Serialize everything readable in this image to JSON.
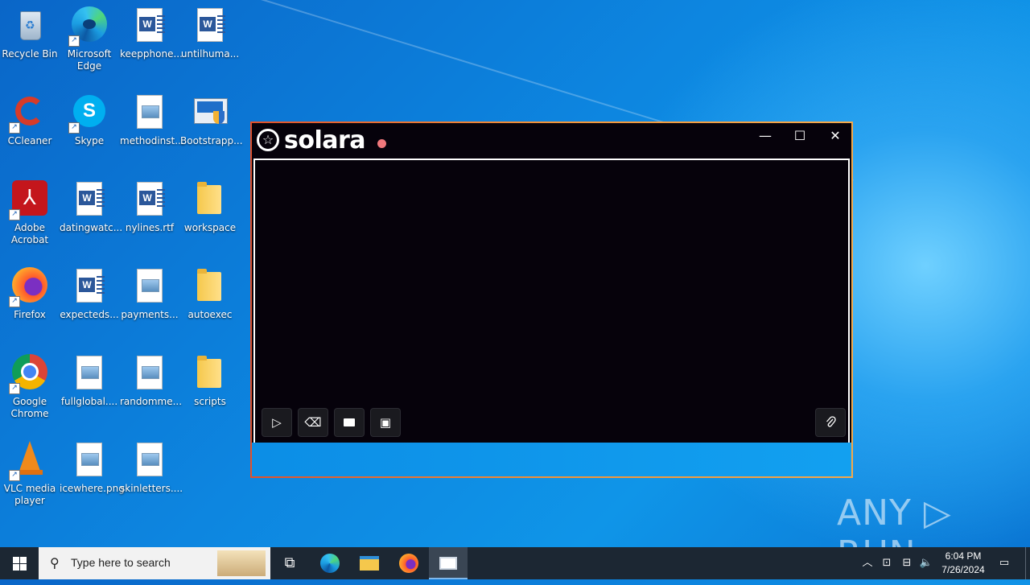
{
  "desktop": {
    "icons": [
      {
        "label": "Recycle Bin",
        "type": "recycle-bin"
      },
      {
        "label": "Microsoft Edge",
        "type": "edge"
      },
      {
        "label": "keepphone...",
        "type": "word"
      },
      {
        "label": "untilhuma...",
        "type": "word"
      },
      {
        "label": "CCleaner",
        "type": "ccleaner"
      },
      {
        "label": "Skype",
        "type": "skype"
      },
      {
        "label": "methodinst...",
        "type": "image"
      },
      {
        "label": "Bootstrapp...",
        "type": "installer"
      },
      {
        "label": "Adobe Acrobat",
        "type": "acrobat"
      },
      {
        "label": "datingwatc...",
        "type": "word"
      },
      {
        "label": "nylines.rtf",
        "type": "word"
      },
      {
        "label": "workspace",
        "type": "folder"
      },
      {
        "label": "Firefox",
        "type": "firefox"
      },
      {
        "label": "expecteds...",
        "type": "word"
      },
      {
        "label": "payments...",
        "type": "image"
      },
      {
        "label": "autoexec",
        "type": "folder"
      },
      {
        "label": "Google Chrome",
        "type": "chrome"
      },
      {
        "label": "fullglobal....",
        "type": "image"
      },
      {
        "label": "randomme...",
        "type": "image"
      },
      {
        "label": "scripts",
        "type": "folder"
      },
      {
        "label": "VLC media player",
        "type": "vlc"
      },
      {
        "label": "icewhere.png",
        "type": "image"
      },
      {
        "label": "skinletters....",
        "type": "image"
      }
    ]
  },
  "solara": {
    "brand": "solara",
    "status_color": "#f0787c",
    "controls": {
      "minimize": "—",
      "maximize": "☐",
      "close": "✕"
    },
    "toolbar": [
      {
        "name": "execute-button",
        "icon": "play-icon",
        "glyph": "▷"
      },
      {
        "name": "clear-button",
        "icon": "eraser-icon",
        "glyph": "⌫"
      },
      {
        "name": "open-file-button",
        "icon": "folder-icon",
        "glyph": "▬"
      },
      {
        "name": "save-file-button",
        "icon": "save-icon",
        "glyph": "▣"
      }
    ],
    "attach_icon": "paperclip-icon"
  },
  "watermark": "ANY ▷ RUN",
  "taskbar": {
    "search_placeholder": "Type here to search",
    "pinned": [
      "task-view-icon",
      "edge-icon",
      "file-explorer-icon",
      "firefox-icon",
      "solara-icon"
    ],
    "time": "6:04 PM",
    "date": "7/26/2024"
  }
}
